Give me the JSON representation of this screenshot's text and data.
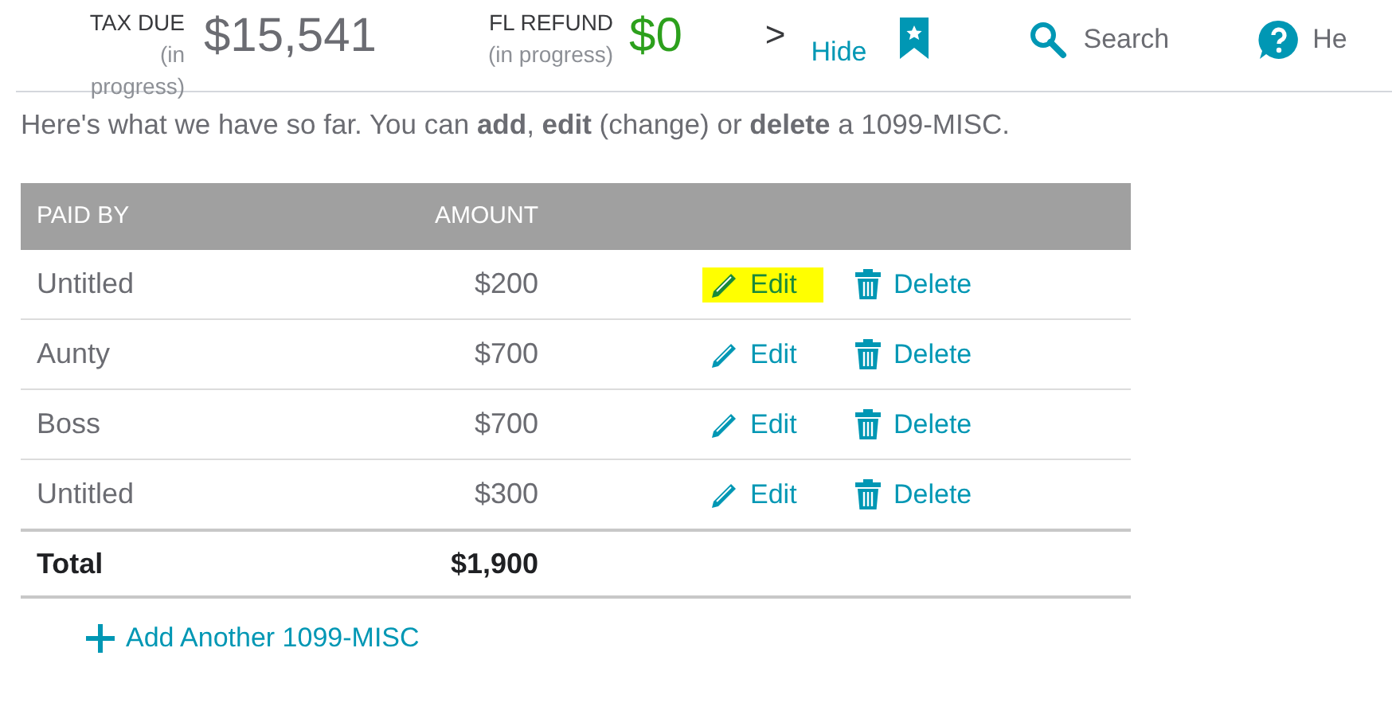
{
  "header": {
    "tax_due": {
      "label": "TAX DUE",
      "note": "(in progress)",
      "amount": "$15,541"
    },
    "refund": {
      "label": "FL REFUND",
      "note": "(in progress)",
      "amount": "$0"
    },
    "expand": ">",
    "hide": "Hide",
    "search": "Search",
    "help": "He"
  },
  "intro": "Here's what we have so far. You can **add**, **edit** (change) or **delete** a 1099-MISC.",
  "table": {
    "columns": [
      "PAID BY",
      "AMOUNT"
    ],
    "rows": [
      {
        "paid_by": "Untitled",
        "amount": "$200",
        "edit": "Edit",
        "delete": "Delete",
        "highlighted": true
      },
      {
        "paid_by": "Aunty",
        "amount": "$700",
        "edit": "Edit",
        "delete": "Delete",
        "highlighted": false
      },
      {
        "paid_by": "Boss",
        "amount": "$700",
        "edit": "Edit",
        "delete": "Delete",
        "highlighted": false
      },
      {
        "paid_by": "Untitled",
        "amount": "$300",
        "edit": "Edit",
        "delete": "Delete",
        "highlighted": false
      }
    ],
    "total": {
      "label": "Total",
      "amount": "$1,900"
    }
  },
  "add_link": "Add Another 1099-MISC"
}
